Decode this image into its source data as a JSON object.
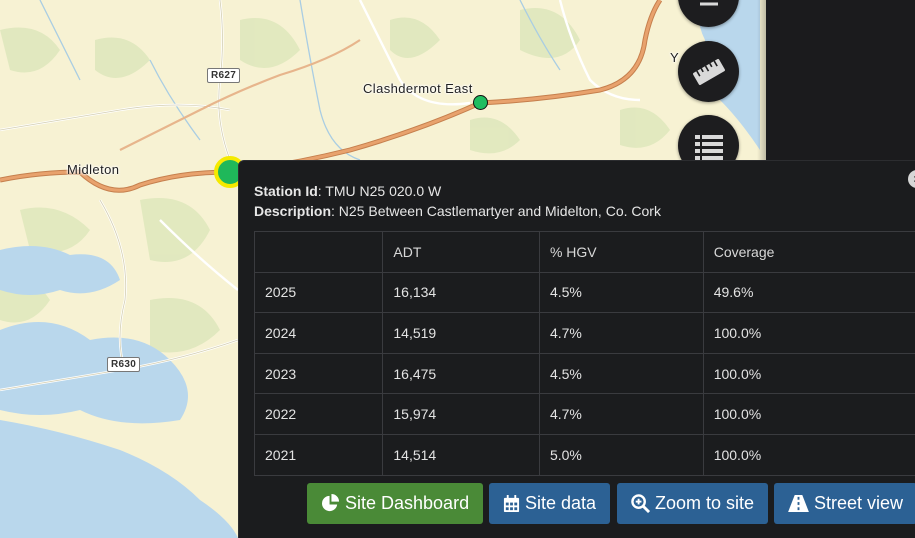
{
  "map": {
    "places": [
      {
        "name": "Midleton"
      },
      {
        "name": "Clashdermot East"
      },
      {
        "name": "Y"
      }
    ],
    "road_shields": [
      "R627",
      "R630"
    ],
    "controls": [
      {
        "icon": "ruler-icon",
        "label": "Measure"
      },
      {
        "icon": "list-icon",
        "label": "Legend"
      }
    ]
  },
  "popup": {
    "station_id_label": "Station Id",
    "station_id": ": TMU N25 020.0 W",
    "description_label": "Description",
    "description": ": N25 Between Castlemartyer and Midelton, Co. Cork",
    "table": {
      "headers": [
        "",
        "ADT",
        "% HGV",
        "Coverage"
      ],
      "rows": [
        [
          "2025",
          "16,134",
          "4.5%",
          "49.6%"
        ],
        [
          "2024",
          "14,519",
          "4.7%",
          "100.0%"
        ],
        [
          "2023",
          "16,475",
          "4.5%",
          "100.0%"
        ],
        [
          "2022",
          "15,974",
          "4.7%",
          "100.0%"
        ],
        [
          "2021",
          "14,514",
          "5.0%",
          "100.0%"
        ]
      ]
    },
    "buttons": {
      "dashboard": "Site Dashboard",
      "data": "Site data",
      "zoom": "Zoom to site",
      "street": "Street view"
    }
  },
  "colors": {
    "selected_marker": "#1fb85a",
    "marker_ring": "#f5ea00",
    "button_green": "#4a8a37",
    "button_blue": "#2c6194",
    "land": "#f7f2d3",
    "water": "#b9d7ec",
    "road": "#e59a63"
  }
}
